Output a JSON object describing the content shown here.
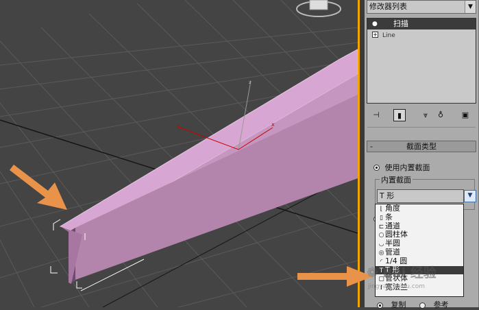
{
  "panel": {
    "modifier_list_label": "修改器列表",
    "stack": [
      {
        "label": "扫描",
        "active": true
      },
      {
        "label": "Line",
        "active": false
      }
    ]
  },
  "rollout": {
    "title": "截面类型",
    "use_builtin_label": "使用内置截面",
    "builtin_group_label": "内置截面",
    "selected_section": "T 形",
    "section_options": [
      {
        "icon": "angle-icon",
        "glyph": "⌊",
        "label": "角度"
      },
      {
        "icon": "bar-icon",
        "glyph": "▯",
        "label": "条"
      },
      {
        "icon": "channel-icon",
        "glyph": "⊏",
        "label": "通道"
      },
      {
        "icon": "cylinder-icon",
        "glyph": "○",
        "label": "圆柱体"
      },
      {
        "icon": "half-round-icon",
        "glyph": "◡",
        "label": "半圆"
      },
      {
        "icon": "pipe-icon",
        "glyph": "◎",
        "label": "管道"
      },
      {
        "icon": "quarter-round-icon",
        "glyph": "◜",
        "label": "1/4 圆"
      },
      {
        "icon": "tee-icon",
        "glyph": "T",
        "label": "T 形"
      },
      {
        "icon": "tube-icon",
        "glyph": "▢",
        "label": "管状体"
      },
      {
        "icon": "wide-flange-icon",
        "glyph": "I",
        "label": "宽法兰"
      }
    ],
    "selected_index": 7,
    "bottom_radio_1": "复制",
    "bottom_radio_2": "参考"
  },
  "watermark": {
    "brand": "Bai",
    "text": "经验",
    "url": "jingyan.baidu.com"
  },
  "colors": {
    "viewport_bg": "#444444",
    "object_fill": "#c89ac3",
    "arrow_orange": "#e8924a",
    "active_border": "#f2a500"
  }
}
